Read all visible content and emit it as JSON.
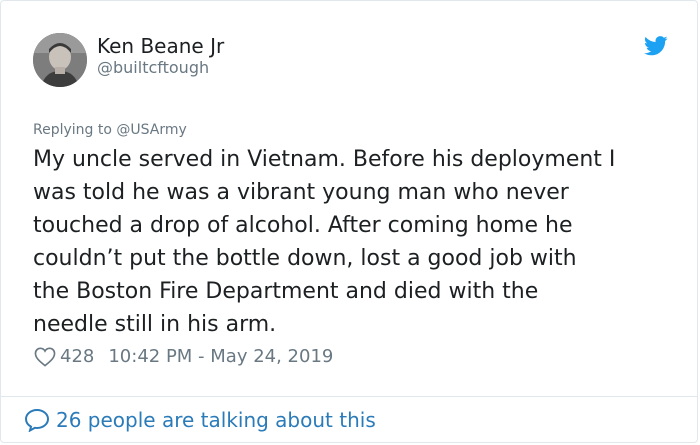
{
  "author": {
    "name": "Ken Beane Jr",
    "handle": "@builtcftough"
  },
  "tweet": {
    "reply_prefix": "Replying to ",
    "reply_to": "@USArmy",
    "text": "My uncle served in Vietnam. Before his deployment I\nwas told he was a vibrant young man who never\ntouched a drop of alcohol. After coming home he\ncouldn’t put the bottle down, lost a good job with\nthe Boston Fire Department and died with the\nneedle still in his arm.",
    "likes": "428",
    "timestamp": "10:42 PM - May 24, 2019"
  },
  "footer": {
    "talking_label": "26 people are talking about this"
  },
  "colors": {
    "twitter_blue": "#1da1f2",
    "link_blue": "#2b7bb9",
    "text": "#1c2022",
    "muted": "#697882",
    "border": "#e1e8ed"
  },
  "icons": [
    "avatar-photo",
    "twitter-bird-icon",
    "heart-icon",
    "speech-bubble-icon"
  ]
}
